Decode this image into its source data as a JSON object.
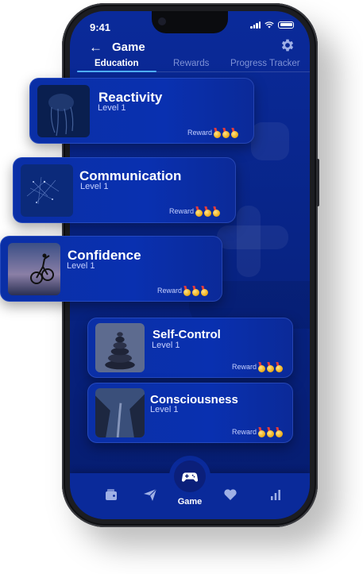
{
  "status": {
    "time": "9:41"
  },
  "header": {
    "back_icon": "arrow-left-icon",
    "title": "Game",
    "settings_icon": "gear-icon"
  },
  "tabs": [
    {
      "label": "Education",
      "active": true
    },
    {
      "label": "Rewards",
      "active": false
    },
    {
      "label": "Progress Tracker",
      "active": false
    }
  ],
  "lessons": [
    {
      "title": "Reactivity",
      "level": "Level 1",
      "reward_label": "Reward",
      "medals": 3
    },
    {
      "title": "Communication",
      "level": "Level 1",
      "reward_label": "Reward",
      "medals": 3
    },
    {
      "title": "Confidence",
      "level": "Level 1",
      "reward_label": "Reward",
      "medals": 3
    },
    {
      "title": "Self-Control",
      "level": "Level 1",
      "reward_label": "Reward",
      "medals": 3
    },
    {
      "title": "Consciousness",
      "level": "Level 1",
      "reward_label": "Reward",
      "medals": 3
    }
  ],
  "bottom_nav": {
    "items": [
      "wallet-icon",
      "send-icon",
      "gamepad-icon",
      "heart-icon",
      "bar-chart-icon"
    ],
    "active_label": "Game"
  },
  "colors": {
    "primary": "#0a2fa6",
    "accent": "#4fb0ff",
    "medal": "#f0b21e"
  }
}
